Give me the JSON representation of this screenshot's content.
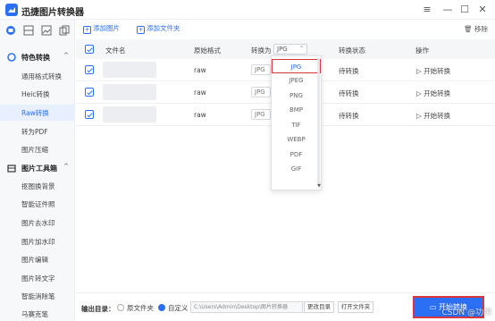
{
  "app": {
    "title": "迅捷图片转换器"
  },
  "window": {
    "menu_icon": "≡",
    "minimize_icon": "—",
    "maximize_icon": "☐",
    "close_icon": "✕"
  },
  "sidebar": {
    "section_convert": {
      "label": "特色转换",
      "chevron": "^"
    },
    "convert_items": [
      {
        "label": "通用格式转换"
      },
      {
        "label": "Heic转换"
      },
      {
        "label": "Raw转换",
        "active": true
      },
      {
        "label": "转为PDF"
      },
      {
        "label": "图片压缩"
      }
    ],
    "section_tools": {
      "label": "图片工具箱",
      "chevron": "^"
    },
    "tool_items": [
      {
        "label": "抠图换背景"
      },
      {
        "label": "智能证件照"
      },
      {
        "label": "图片去水印"
      },
      {
        "label": "图片加水印"
      },
      {
        "label": "图片编辑"
      },
      {
        "label": "图片转文字"
      },
      {
        "label": "智能消除笔"
      },
      {
        "label": "马赛克笔"
      }
    ]
  },
  "toolbar": {
    "add_image": "添加图片",
    "add_folder": "添加文件夹",
    "remove": "移除"
  },
  "table": {
    "headers": {
      "name": "文件名",
      "source_format": "原始格式",
      "convert_to": "转换为",
      "status": "转换状态",
      "action": "操作"
    },
    "header_format_value": "JPG",
    "rows": [
      {
        "source_format": "raw",
        "target": "JPG",
        "status": "待转换",
        "action": "开始转换"
      },
      {
        "source_format": "raw",
        "target": "JPG",
        "status": "待转换",
        "action": "开始转换"
      },
      {
        "source_format": "raw",
        "target": "JPG",
        "status": "待转换",
        "action": "开始转换"
      }
    ]
  },
  "dropdown": {
    "options": [
      "JPG",
      "JPEG",
      "PNG",
      "BMP",
      "TIF",
      "WEBP",
      "PDF",
      "GIF"
    ],
    "selected": "JPG"
  },
  "footer": {
    "output_label": "输出目录：",
    "option_source": "原文件夹",
    "option_custom": "自定义",
    "path": "C:\\Users\\Admin\\Desktop\\图片转换器",
    "change_dir": "更改目录",
    "open_folder": "打开文件夹",
    "start_all": "开始转换"
  },
  "watermark": "CSDN @功阴",
  "colors": {
    "accent": "#2b6ff5",
    "highlight": "#d9363e"
  }
}
